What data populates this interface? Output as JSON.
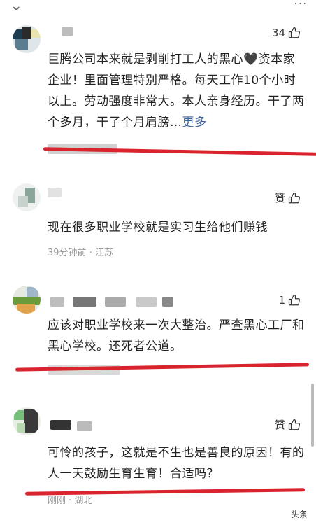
{
  "comments": [
    {
      "likes": "34",
      "text": "巨腾公司本来就是剥削打工人的黑心🖤资本家企业！里面管理特别严格。每天工作10个小时以上。劳动强度非常大。本人亲身经历。干了两个多月，干了个月肩膀…",
      "more": "更多"
    },
    {
      "likes": "赞",
      "text": "现在很多职业学校就是实习生给他们赚钱",
      "meta": "39分钟前 · 江苏"
    },
    {
      "likes": "1",
      "text": "应该对职业学校来一次大整治。严查黑心工厂和黑心学校。还死者公道。"
    },
    {
      "likes": "赞",
      "text": "可怜的孩子，这就是不生也是善良的原因！有的人一天鼓励生育生育！合适吗？",
      "meta": "刚刚 · 湖北"
    }
  ],
  "watermark": "头条"
}
